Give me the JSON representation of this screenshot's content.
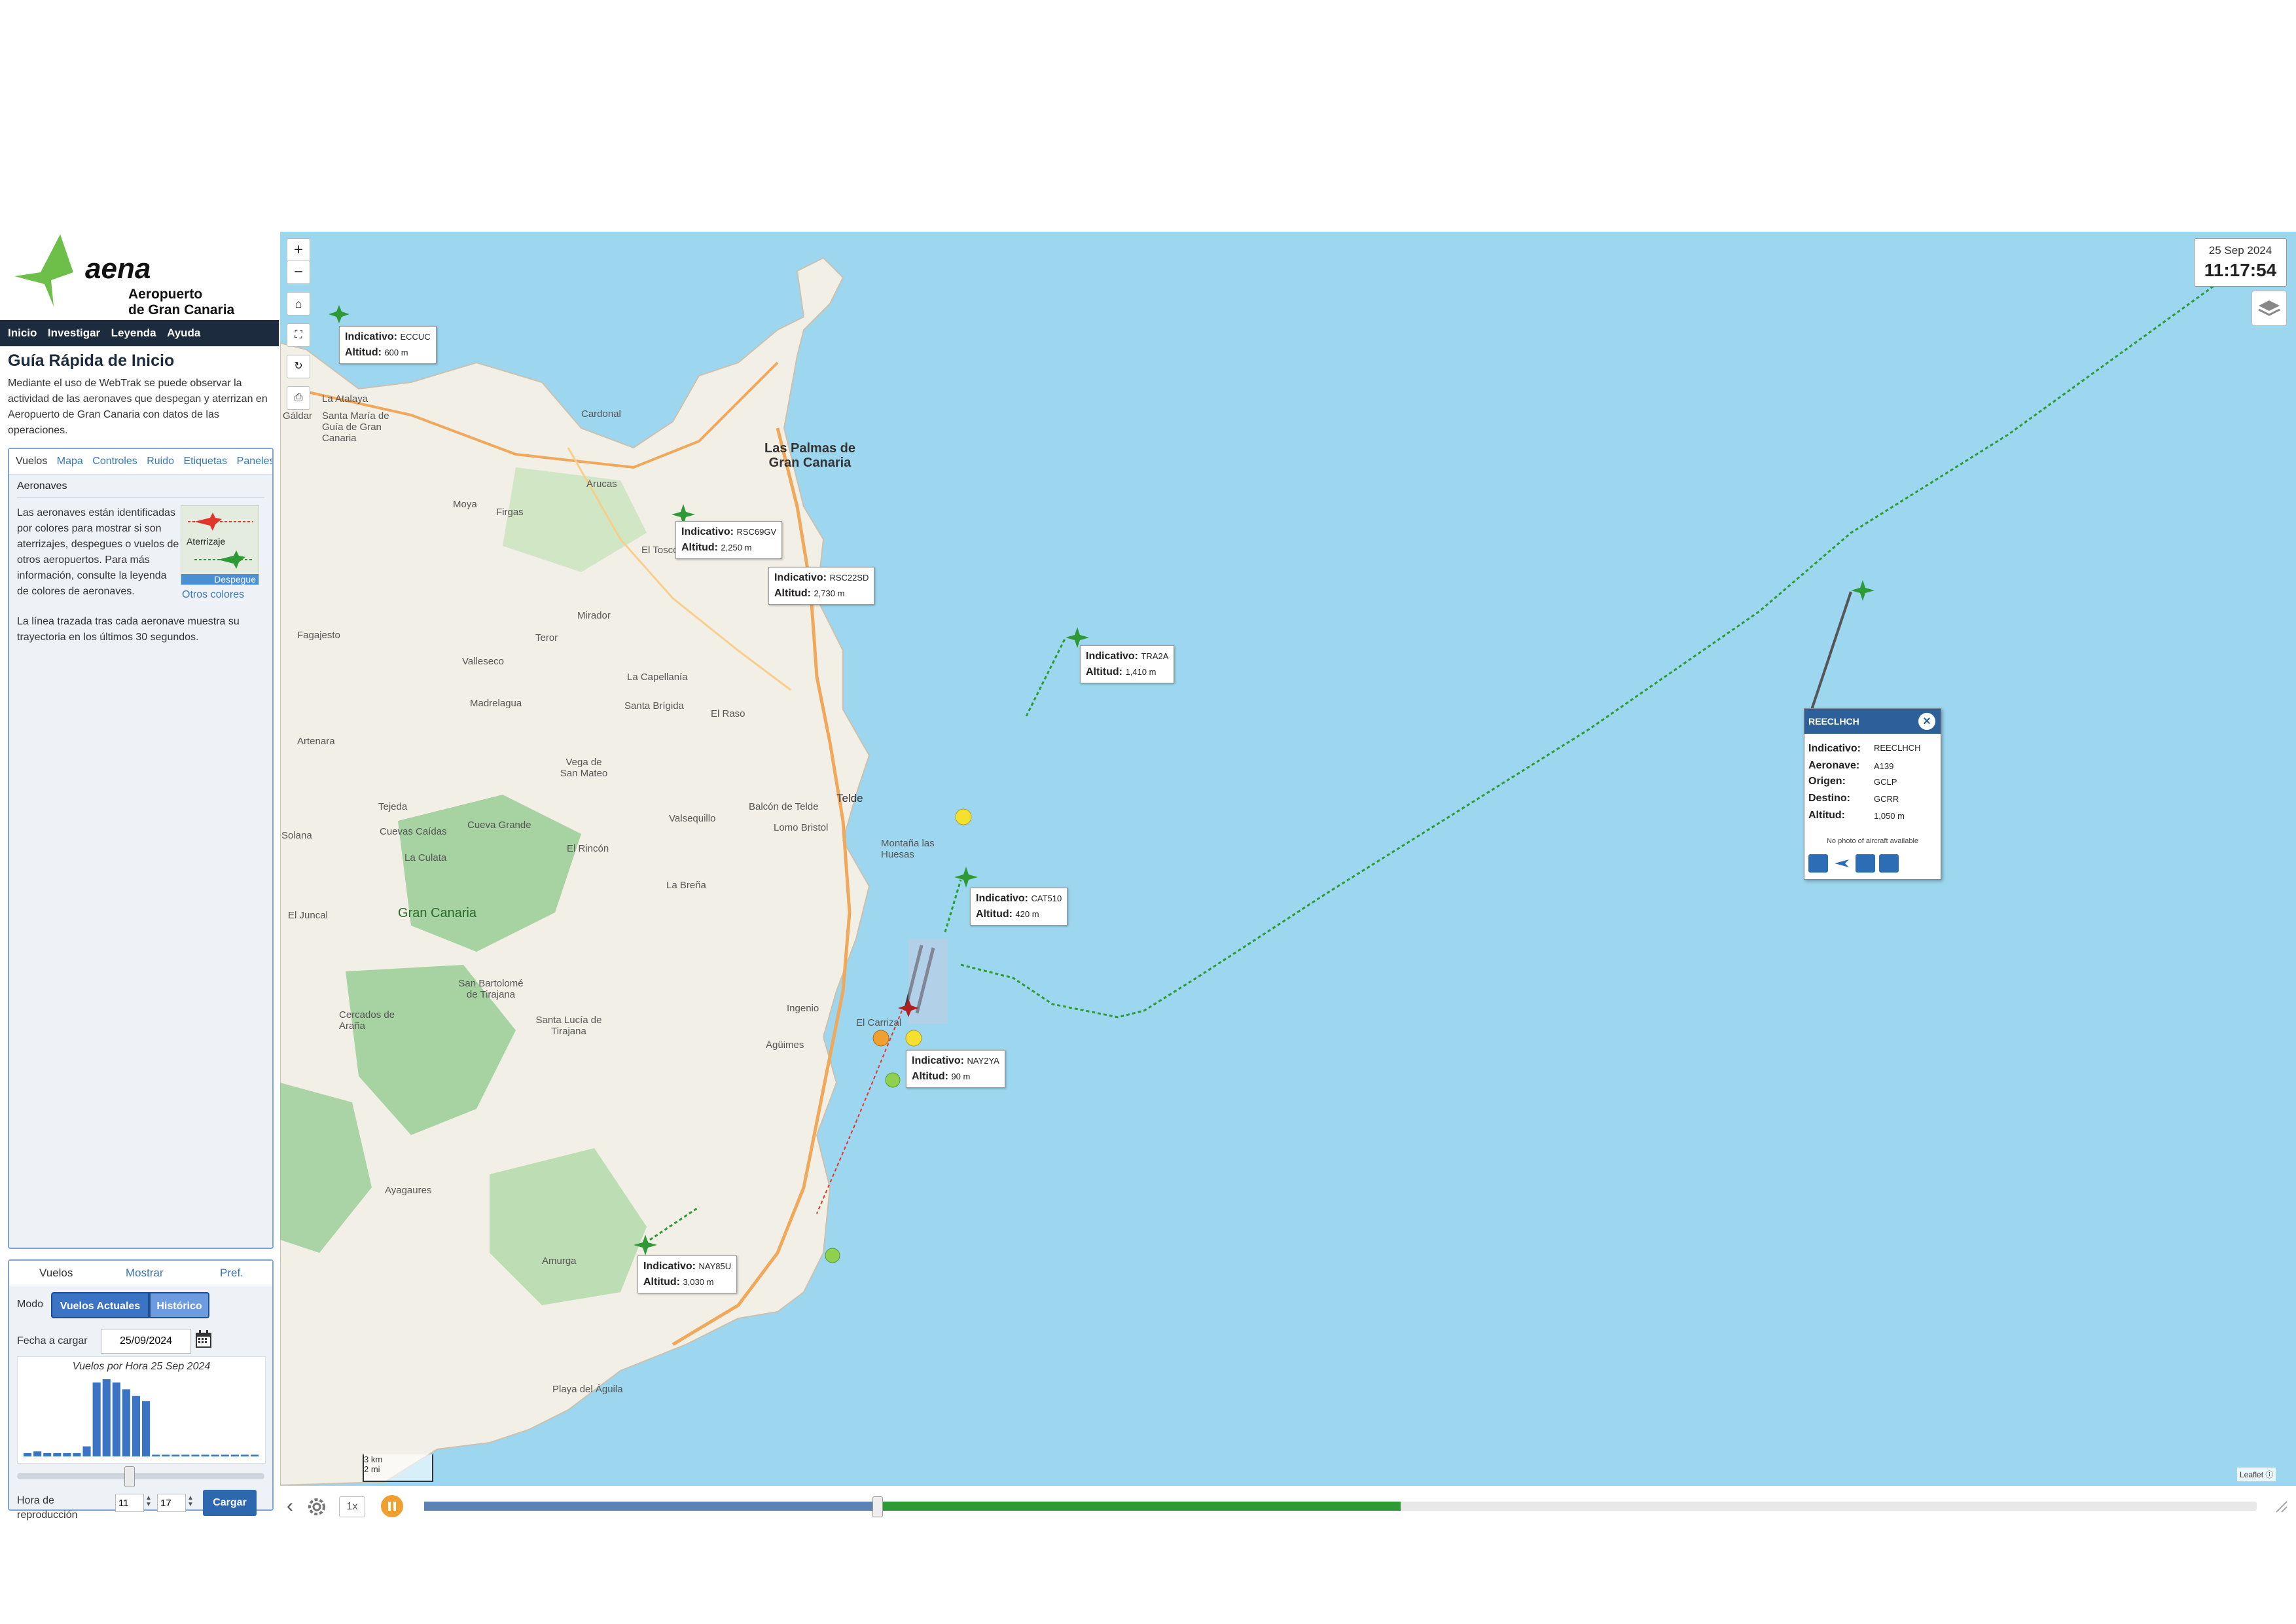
{
  "sidebar": {
    "logo": {
      "word": "aena",
      "line1": "Aeropuerto",
      "line2": "de Gran Canaria"
    },
    "menu": [
      "Inicio",
      "Investigar",
      "Leyenda",
      "Ayuda"
    ],
    "guide_title": "Guía Rápida de Inicio",
    "guide_text": "Mediante el uso de WebTrak se puede observar la actividad de las aeronaves que despegan y aterrizan en Aeropuerto de Gran Canaria con datos de las operaciones.",
    "info_tabs": [
      "Vuelos",
      "Mapa",
      "Controles",
      "Ruido",
      "Etiquetas",
      "Paneles"
    ],
    "info_heading": "Aeronaves",
    "info_body": "Las aeronaves están identificadas por colores para mostrar si son aterrizajes, despegues o vuelos de otros aeropuertos. Para más información, consulte la leyenda de colores de aeronaves.",
    "info_body2": "La línea trazada tras cada aeronave muestra su trayectoria en los últimos 30 segundos.",
    "legend_landing": "Aterrizaje",
    "legend_departure": "Despegue",
    "other_colors": "Otros colores"
  },
  "controls": {
    "tabs": [
      "Vuelos",
      "Mostrar",
      "Pref."
    ],
    "mode_label": "Modo",
    "mode_current": "Vuelos Actuales",
    "mode_history": "Histórico",
    "date_label": "Fecha a cargar",
    "date_value": "25/09/2024",
    "histogram_title": "Vuelos por Hora 25 Sep 2024",
    "histogram_values": [
      2,
      3,
      2,
      2,
      2,
      2,
      6,
      44,
      46,
      44,
      40,
      36,
      33,
      1,
      1,
      1,
      1,
      1,
      1,
      1,
      1,
      1,
      1,
      1
    ],
    "hour_label": "Hora de reproducción",
    "hour_value": "11",
    "minute_value": "17",
    "load_button": "Cargar"
  },
  "map": {
    "date": "25 Sep 2024",
    "time": "11:17:54",
    "zoom_in": "+",
    "zoom_out": "−",
    "scale_km": "3 km",
    "scale_mi": "2 mi",
    "attribution": "Leaflet",
    "city_labels": [
      "Las Palmas de",
      "Gran Canaria"
    ],
    "place_labels": [
      "Gáldar",
      "La Atalaya",
      "Santa María de Guía de Gran Canaria",
      "Cardonal",
      "Arucas",
      "Moya",
      "Firgas",
      "El Toscón",
      "Teror",
      "Valleseco",
      "Madrelagua",
      "La Capellanía",
      "Santa Brígida",
      "El Raso",
      "Vega de San Mateo",
      "Fagajesto",
      "Artenara",
      "Tejeda",
      "Cuevas Caídas",
      "Cueva Grande",
      "La Culata",
      "El Rincón",
      "Valsequillo",
      "Telde",
      "Balcón de Telde",
      "Lomo Bristol",
      "Montaña las Huesas",
      "La Breña",
      "Gran Canaria",
      "El Juncal",
      "San Bartolomé de Tirajana",
      "Santa Lucía de Tirajana",
      "Ingenio",
      "Agüimes",
      "Cercados de Araña",
      "Ayagaures",
      "Amurga",
      "Playa del Águila",
      "Solana",
      "El Carrizal",
      "Mirador"
    ],
    "flights": [
      {
        "callsign": "ECCUC",
        "altitude": "600 m"
      },
      {
        "callsign": "RSC69GV",
        "altitude": "2,250 m"
      },
      {
        "callsign": "RSC22SD",
        "altitude": "2,730 m"
      },
      {
        "callsign": "TRA2A",
        "altitude": "1,410 m"
      },
      {
        "callsign": "CAT510",
        "altitude": "420 m"
      },
      {
        "callsign": "NAY2YA",
        "altitude": "90 m"
      },
      {
        "callsign": "NAY85U",
        "altitude": "3,030 m"
      }
    ],
    "tag_callsign_label": "Indicativo:",
    "tag_altitude_label": "Altitud:",
    "popup": {
      "title": "REECLHCH",
      "callsign_label": "Indicativo:",
      "callsign": "REECLHCH",
      "aircraft_label": "Aeronave:",
      "aircraft": "A139",
      "origin_label": "Origen:",
      "origin": "GCLP",
      "destination_label": "Destino:",
      "destination": "GCRR",
      "altitude_label": "Altitud:",
      "altitude": "1,050 m",
      "no_photo": "No photo of aircraft available"
    },
    "timebar": {
      "speed": "1x",
      "progress_played": 0.247,
      "progress_loaded": 0.533
    },
    "colors": {
      "sea": "#9cd6ef",
      "land": "#f2efe6",
      "forest": "#8cc98a",
      "departure": "#2e9a36",
      "arrival": "#e0362c",
      "header": "#1d2b3f",
      "accent": "#3b74c4"
    }
  }
}
